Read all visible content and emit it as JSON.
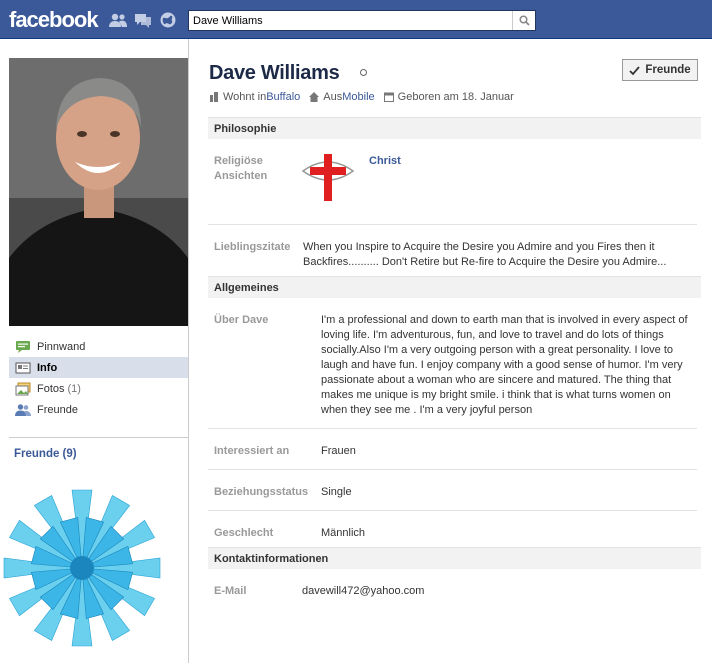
{
  "header": {
    "logo": "facebook",
    "search_value": "Dave Williams",
    "icons": [
      "friend-requests-icon",
      "messages-icon",
      "notifications-icon",
      "search-icon"
    ]
  },
  "sidebar": {
    "profile_photo": "profile-photo",
    "nav": [
      {
        "label": "Pinnwand",
        "count": "",
        "icon": "wall-icon"
      },
      {
        "label": "Info",
        "count": "",
        "icon": "info-icon"
      },
      {
        "label": "Fotos",
        "count": "(1)",
        "icon": "photos-icon"
      },
      {
        "label": "Freunde",
        "count": "",
        "icon": "friends-icon"
      }
    ],
    "friends_heading": "Freunde (9)"
  },
  "profile": {
    "name": "Dave Williams",
    "friends_button": "Freunde",
    "meta": {
      "lives_prefix": "Wohnt in ",
      "lives_city": "Buffalo",
      "from_prefix": "Aus ",
      "from_city": "Mobile",
      "born": "Geboren am 18. Januar"
    }
  },
  "sections": {
    "philosophy": {
      "title": "Philosophie",
      "religion_label": "Religiöse Ansichten",
      "religion_value": "Christ",
      "quotes_label": "Lieblingszitate",
      "quotes_value": "When you Inspire to Acquire the Desire you Admire and you Fires then it Backfires.......... Don't Retire but Re-fire to Acquire the Desire you Admire..."
    },
    "general": {
      "title": "Allgemeines",
      "about_label": "Über Dave",
      "about_value": "I'm a professional and down to earth man that is involved in every aspect of loving life. I'm adventurous, fun, and love to travel and do lots of things socially.Also I'm a very outgoing person with a great personality. I love to laugh and have fun. I enjoy company with a good sense of humor. I'm very passionate about a woman who are sincere and matured. The thing that makes me unique is my bright smile. i think that is what turns women on when they see me . I'm a very joyful person",
      "interested_label": "Interessiert an",
      "interested_value": "Frauen",
      "relationship_label": "Beziehungsstatus",
      "relationship_value": "Single",
      "gender_label": "Geschlecht",
      "gender_value": "Männlich"
    },
    "contact": {
      "title": "Kontaktinformationen",
      "email_label": "E-Mail",
      "email_value": "davewill472@yahoo.com"
    }
  },
  "colors": {
    "brand": "#3b5998",
    "nav_active": "#d8dfea",
    "section_bg": "#f2f2f2",
    "religion_cross": "#e02020"
  }
}
